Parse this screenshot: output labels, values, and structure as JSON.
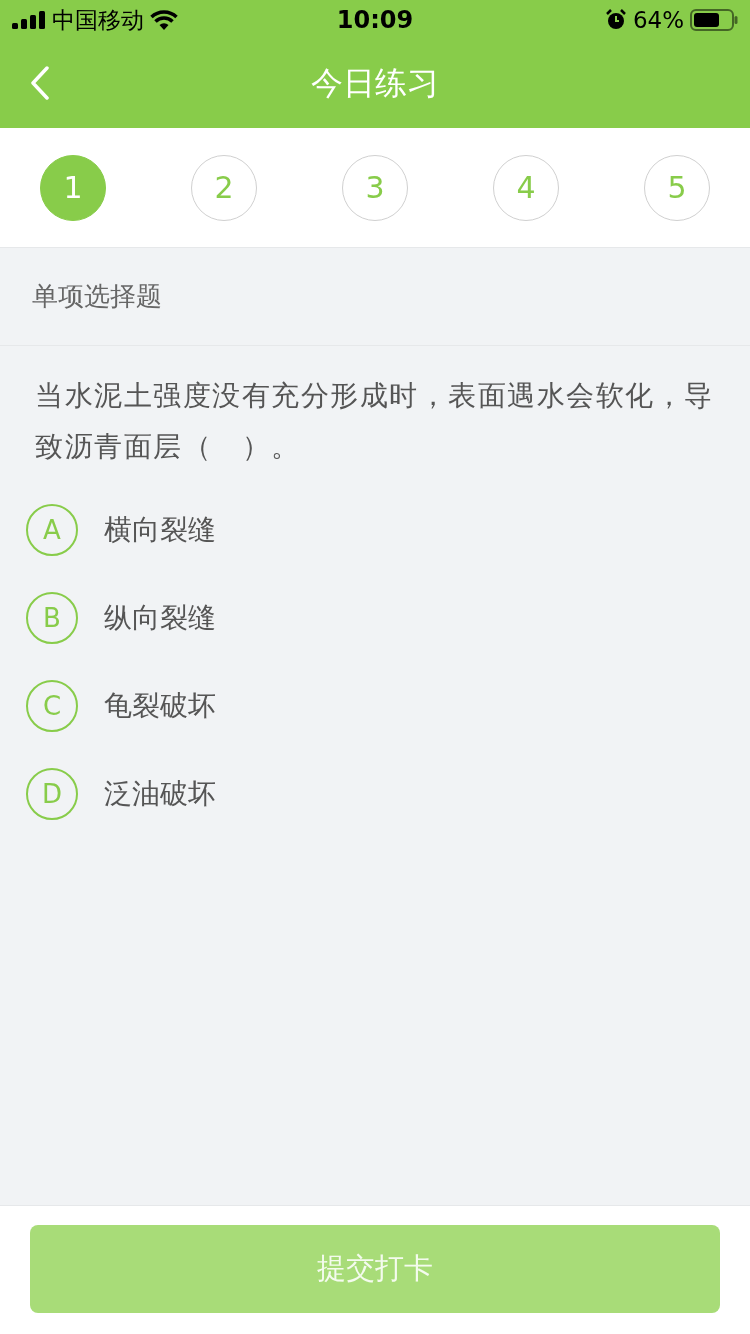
{
  "status_bar": {
    "carrier": "中国移动",
    "time": "10:09",
    "battery": "64%"
  },
  "nav": {
    "title": "今日练习"
  },
  "steps": [
    {
      "label": "1",
      "selected": true
    },
    {
      "label": "2",
      "selected": false
    },
    {
      "label": "3",
      "selected": false
    },
    {
      "label": "4",
      "selected": false
    },
    {
      "label": "5",
      "selected": false
    }
  ],
  "question": {
    "type_label": "单项选择题",
    "text": "当水泥土强度没有充分形成时，表面遇水会软化，导致沥青面层（　）。",
    "options": [
      {
        "letter": "A",
        "text": "横向裂缝",
        "selected": false
      },
      {
        "letter": "B",
        "text": "纵向裂缝",
        "selected": false
      },
      {
        "letter": "C",
        "text": "龟裂破坏",
        "selected": false
      },
      {
        "letter": "D",
        "text": "泛油破坏",
        "selected": false
      }
    ]
  },
  "submit": {
    "label": "提交打卡",
    "disabled": true
  }
}
